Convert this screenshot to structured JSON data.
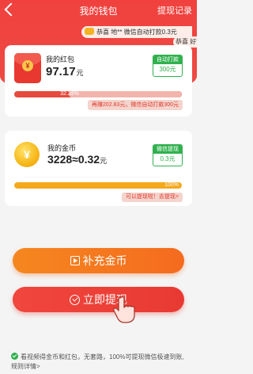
{
  "header": {
    "title": "我的钱包",
    "records_label": "提现记录"
  },
  "ticker": {
    "main": "恭喜 地** 微信自动打款0.3元",
    "secondary": "恭喜 好*"
  },
  "red_envelope": {
    "label": "我的红包",
    "amount": "97.17",
    "unit": "元",
    "auto_pay_label": "自动打款",
    "auto_pay_value": "300元",
    "progress_percent": 32.39,
    "progress_text": "32.39%",
    "tip": "再赚202.83元，微信自动打款300元"
  },
  "gold": {
    "label": "我的金币",
    "amount": "3228≈0.32",
    "unit": "元",
    "withdraw_label": "微信提现",
    "withdraw_value": "0.3元",
    "progress_percent": 100,
    "progress_text": "100%",
    "tip": "可以提现啦！去提现>"
  },
  "buttons": {
    "recharge": "补充金币",
    "withdraw": "立即提现"
  },
  "footnote": "看视频得金币和红包，无套路，100%可提现微信极速到账,规则详情>",
  "colors": {
    "brand_red": "#f0413e",
    "green": "#30b14e",
    "orange": "#f5871f",
    "gold": "#f5a81c"
  }
}
